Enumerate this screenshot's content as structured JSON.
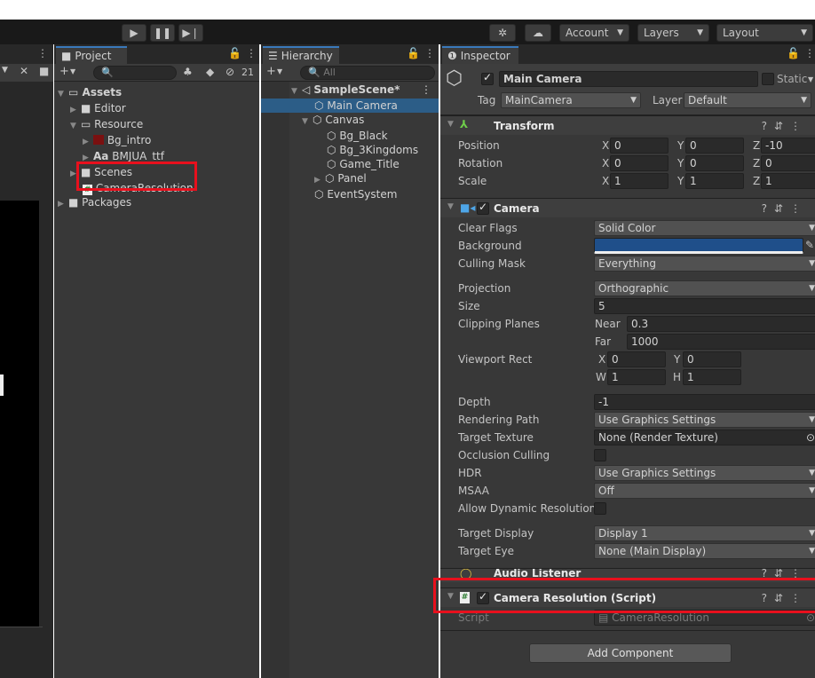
{
  "toolbar": {
    "play_icon": "play-icon",
    "pause_icon": "pause-icon",
    "step_icon": "step-icon",
    "account": "Account",
    "layers": "Layers",
    "layout": "Layout"
  },
  "project": {
    "tab": "Project",
    "hidden_count": "21",
    "search_placeholder": "",
    "tree": {
      "assets": "Assets",
      "editor": "Editor",
      "resource": "Resource",
      "bg_intro": "Bg_intro",
      "font_prefix": "Aa",
      "font": "BMJUA_ttf",
      "scenes": "Scenes",
      "camera_resolution": "CameraResolution",
      "packages": "Packages"
    }
  },
  "hierarchy": {
    "tab": "Hierarchy",
    "search_placeholder": "All",
    "scene": "SampleScene*",
    "items": {
      "main_camera": "Main Camera",
      "canvas": "Canvas",
      "bg_black": "Bg_Black",
      "bg_3kingdoms": "Bg_3Kingdoms",
      "game_title": "Game_Title",
      "panel": "Panel",
      "event_system": "EventSystem"
    }
  },
  "inspector": {
    "tab": "Inspector",
    "object_name": "Main Camera",
    "static_label": "Static",
    "tag_label": "Tag",
    "tag_value": "MainCamera",
    "layer_label": "Layer",
    "layer_value": "Default",
    "transform": {
      "title": "Transform",
      "position_label": "Position",
      "rotation_label": "Rotation",
      "scale_label": "Scale",
      "x": "X",
      "y": "Y",
      "z": "Z",
      "position": [
        "0",
        "0",
        "-10"
      ],
      "rotation": [
        "0",
        "0",
        "0"
      ],
      "scale": [
        "1",
        "1",
        "1"
      ]
    },
    "camera": {
      "title": "Camera",
      "clear_flags_label": "Clear Flags",
      "clear_flags": "Solid Color",
      "background_label": "Background",
      "background_color": "#1f4f8a",
      "culling_mask_label": "Culling Mask",
      "culling_mask": "Everything",
      "projection_label": "Projection",
      "projection": "Orthographic",
      "size_label": "Size",
      "size": "5",
      "clipping_label": "Clipping Planes",
      "near_label": "Near",
      "near": "0.3",
      "far_label": "Far",
      "far": "1000",
      "viewport_label": "Viewport Rect",
      "vx_label": "X",
      "vx": "0",
      "vy_label": "Y",
      "vy": "0",
      "vw_label": "W",
      "vw": "1",
      "vh_label": "H",
      "vh": "1",
      "depth_label": "Depth",
      "depth": "-1",
      "rendering_path_label": "Rendering Path",
      "rendering_path": "Use Graphics Settings",
      "target_texture_label": "Target Texture",
      "target_texture": "None (Render Texture)",
      "occlusion_label": "Occlusion Culling",
      "hdr_label": "HDR",
      "hdr": "Use Graphics Settings",
      "msaa_label": "MSAA",
      "msaa": "Off",
      "dynres_label": "Allow Dynamic Resolution",
      "target_display_label": "Target Display",
      "target_display": "Display 1",
      "target_eye_label": "Target Eye",
      "target_eye": "None (Main Display)"
    },
    "audio_listener": "Audio Listener",
    "script_component": {
      "title": "Camera Resolution (Script)",
      "script_label": "Script",
      "script_value": "CameraResolution"
    },
    "add_component": "Add Component"
  },
  "colors": {
    "highlight": "#e8101d",
    "selection": "#2c5d87",
    "panel_bg": "#383838"
  }
}
